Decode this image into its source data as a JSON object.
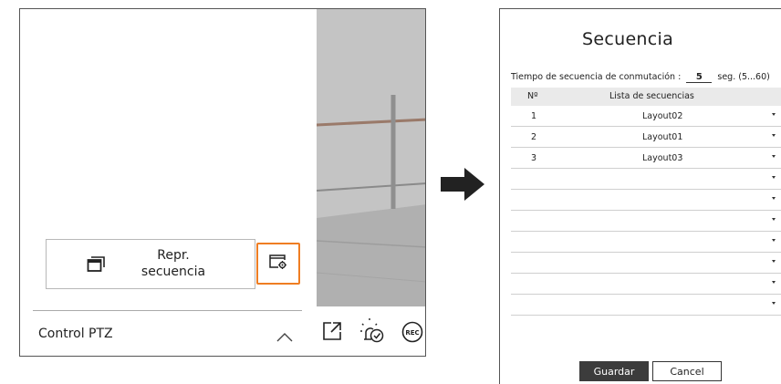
{
  "left_panel": {
    "repr_button_label": "Repr.\nsecuencia",
    "ptz_label": "Control PTZ",
    "icons": [
      "sequence-windows-icon",
      "sequence-settings-icon",
      "chevron-up-icon",
      "popout-icon",
      "alarm-check-icon",
      "rec-icon"
    ]
  },
  "dialog": {
    "title": "Secuencia",
    "interval_label": "Tiempo de secuencia de conmutación :",
    "interval_value": "5",
    "interval_unit": "seg. (5...60)",
    "columns": [
      "Nº",
      "Lista de secuencias"
    ],
    "rows": [
      {
        "no": "1",
        "layout": "Layout02"
      },
      {
        "no": "2",
        "layout": "Layout01"
      },
      {
        "no": "3",
        "layout": "Layout03"
      },
      {
        "no": "",
        "layout": ""
      },
      {
        "no": "",
        "layout": ""
      },
      {
        "no": "",
        "layout": ""
      },
      {
        "no": "",
        "layout": ""
      },
      {
        "no": "",
        "layout": ""
      },
      {
        "no": "",
        "layout": ""
      },
      {
        "no": "",
        "layout": ""
      }
    ],
    "save_label": "Guardar",
    "cancel_label": "Cancel"
  },
  "colors": {
    "highlight": "#ef7d22",
    "save_button": "#3c3c3c"
  }
}
